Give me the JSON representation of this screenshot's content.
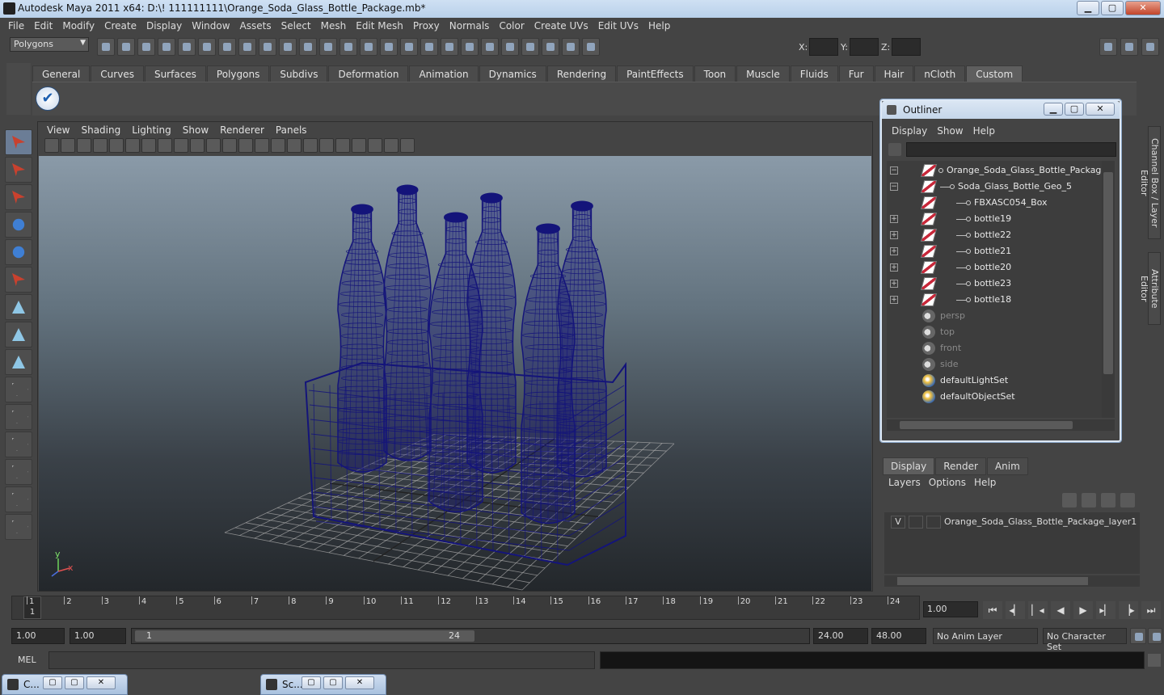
{
  "window": {
    "title": "Autodesk Maya 2011 x64: D:\\! 111111111\\Orange_Soda_Glass_Bottle_Package.mb*",
    "min": "▁",
    "max": "▢",
    "close": "✕"
  },
  "menubar": [
    "File",
    "Edit",
    "Modify",
    "Create",
    "Display",
    "Window",
    "Assets",
    "Select",
    "Mesh",
    "Edit Mesh",
    "Proxy",
    "Normals",
    "Color",
    "Create UVs",
    "Edit UVs",
    "Help"
  ],
  "status_line": {
    "mode": "Polygons",
    "x_label": "X:",
    "y_label": "Y:",
    "z_label": "Z:",
    "x_value": "",
    "y_value": "",
    "z_value": ""
  },
  "shelf": {
    "tabs": [
      "General",
      "Curves",
      "Surfaces",
      "Polygons",
      "Subdivs",
      "Deformation",
      "Animation",
      "Dynamics",
      "Rendering",
      "PaintEffects",
      "Toon",
      "Muscle",
      "Fluids",
      "Fur",
      "Hair",
      "nCloth",
      "Custom"
    ],
    "active_tab": "Custom",
    "check_icon": "✔"
  },
  "viewport": {
    "menu": [
      "View",
      "Shading",
      "Lighting",
      "Show",
      "Renderer",
      "Panels"
    ],
    "axis_y": "y",
    "axis_x": "x",
    "wire_color": "#14147a"
  },
  "outliner": {
    "title": "Outliner",
    "menu": [
      "Display",
      "Show",
      "Help"
    ],
    "filter": "",
    "items": [
      {
        "label": "Orange_Soda_Glass_Bottle_Package",
        "depth": 0,
        "expand": "−",
        "icon": "mesh-icon",
        "dim": false
      },
      {
        "label": "Soda_Glass_Bottle_Geo_5",
        "depth": 1,
        "expand": "−",
        "icon": "mesh-icon",
        "dim": false
      },
      {
        "label": "FBXASC054_Box",
        "depth": 2,
        "expand": "",
        "icon": "poly-icon",
        "dim": false
      },
      {
        "label": "bottle19",
        "depth": 2,
        "expand": "+",
        "icon": "mesh-icon",
        "dim": false
      },
      {
        "label": "bottle22",
        "depth": 2,
        "expand": "+",
        "icon": "mesh-icon",
        "dim": false
      },
      {
        "label": "bottle21",
        "depth": 2,
        "expand": "+",
        "icon": "mesh-icon",
        "dim": false
      },
      {
        "label": "bottle20",
        "depth": 2,
        "expand": "+",
        "icon": "mesh-icon",
        "dim": false
      },
      {
        "label": "bottle23",
        "depth": 2,
        "expand": "+",
        "icon": "mesh-icon",
        "dim": false
      },
      {
        "label": "bottle18",
        "depth": 2,
        "expand": "+",
        "icon": "mesh-icon",
        "dim": false
      },
      {
        "label": "persp",
        "depth": 0,
        "expand": "",
        "icon": "camera-icon",
        "dim": true
      },
      {
        "label": "top",
        "depth": 0,
        "expand": "",
        "icon": "camera-icon",
        "dim": true
      },
      {
        "label": "front",
        "depth": 0,
        "expand": "",
        "icon": "camera-icon",
        "dim": true
      },
      {
        "label": "side",
        "depth": 0,
        "expand": "",
        "icon": "camera-icon",
        "dim": true
      },
      {
        "label": "defaultLightSet",
        "depth": 0,
        "expand": "",
        "icon": "set-icon",
        "dim": false
      },
      {
        "label": "defaultObjectSet",
        "depth": 0,
        "expand": "",
        "icon": "set-icon",
        "dim": false
      }
    ]
  },
  "side_tabs": [
    "Channel Box / Layer Editor",
    "Attribute Editor"
  ],
  "layer_editor": {
    "tabs": [
      "Display",
      "Render",
      "Anim"
    ],
    "active_tab": "Display",
    "menu": [
      "Layers",
      "Options",
      "Help"
    ],
    "layers": [
      {
        "visible": "V",
        "name": "Orange_Soda_Glass_Bottle_Package_layer1"
      }
    ]
  },
  "time_slider": {
    "ticks": [
      "1",
      "2",
      "3",
      "4",
      "5",
      "6",
      "7",
      "8",
      "9",
      "10",
      "11",
      "12",
      "13",
      "14",
      "15",
      "16",
      "17",
      "18",
      "19",
      "20",
      "21",
      "22",
      "23",
      "24"
    ],
    "current_frame_marker": "1",
    "current_time": "1.00",
    "playback": [
      "⏮",
      "◂▏",
      "▏◂",
      "◀",
      "▶",
      "▸▏",
      "▕▸",
      "⏭"
    ]
  },
  "range_slider": {
    "start_time": "1.00",
    "playback_start": "1.00",
    "range_start": "1",
    "range_end": "24",
    "playback_end": "24.00",
    "end_time": "48.00",
    "anim_layer": "No Anim Layer",
    "character_set": "No Character Set"
  },
  "command_line": {
    "label": "MEL",
    "input": "",
    "output": ""
  },
  "minimized": [
    {
      "label": "C..."
    },
    {
      "label": "Sc..."
    }
  ]
}
